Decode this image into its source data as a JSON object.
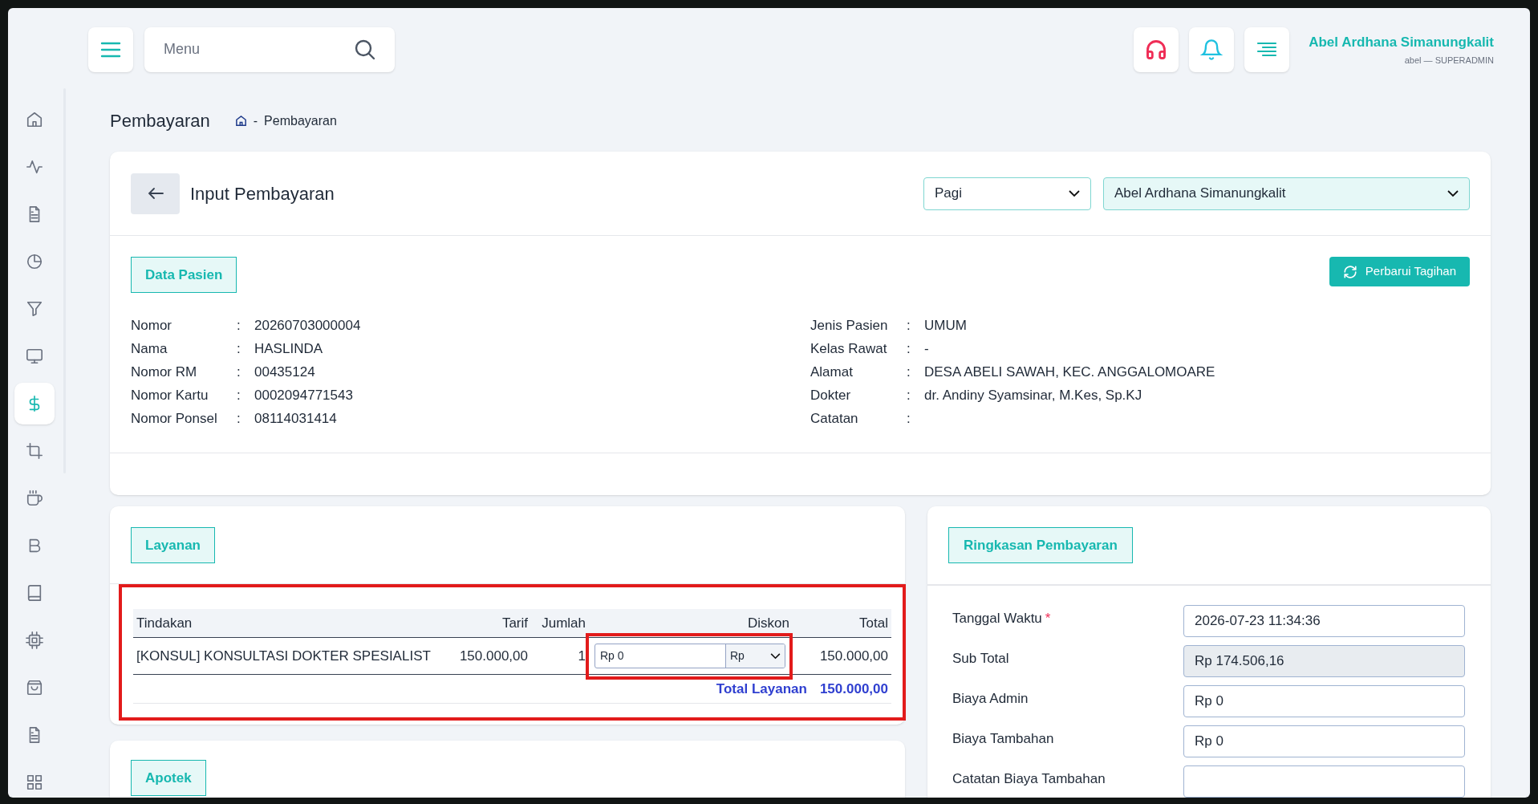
{
  "topbar": {
    "search": {
      "placeholder": "Menu"
    },
    "user": {
      "name": "Abel Ardhana Simanungkalit",
      "role": "abel — SUPERADMIN"
    }
  },
  "sidebar": {
    "items": [
      {
        "kind": "home",
        "selected": false
      },
      {
        "kind": "activity",
        "selected": false
      },
      {
        "kind": "file",
        "selected": false
      },
      {
        "kind": "pie",
        "selected": false
      },
      {
        "kind": "filter",
        "selected": false
      },
      {
        "kind": "monitor",
        "selected": false
      },
      {
        "kind": "dollar",
        "selected": true
      },
      {
        "kind": "crop",
        "selected": false
      },
      {
        "kind": "cup",
        "selected": false
      },
      {
        "kind": "bold",
        "selected": false
      },
      {
        "kind": "book",
        "selected": false
      },
      {
        "kind": "chip",
        "selected": false
      },
      {
        "kind": "bag",
        "selected": false
      },
      {
        "kind": "file",
        "selected": false
      },
      {
        "kind": "grid",
        "selected": false
      }
    ]
  },
  "page": {
    "title": "Pembayaran",
    "breadcrumb": [
      {
        "separator": "-",
        "label": "Pembayaran"
      }
    ]
  },
  "payment_card": {
    "title": "Input Pembayaran",
    "shift_select": {
      "value": "Pagi"
    },
    "staff_select": {
      "value": "Abel Ardhana Simanungkalit"
    },
    "section_label": "Data Pasien",
    "refresh_button": "Perbarui Tagihan",
    "left_fields": [
      {
        "label": "Nomor",
        "colon": ":",
        "value": "20260703000004"
      },
      {
        "label": "Nama",
        "colon": ":",
        "value": "HASLINDA"
      },
      {
        "label": "Nomor RM",
        "colon": ":",
        "value": "00435124"
      },
      {
        "label": "Nomor Kartu",
        "colon": ":",
        "value": "0002094771543"
      },
      {
        "label": "Nomor Ponsel",
        "colon": ":",
        "value": "08114031414"
      }
    ],
    "right_fields": [
      {
        "label": "Jenis Pasien",
        "colon": ":",
        "value": "UMUM"
      },
      {
        "label": "Kelas Rawat",
        "colon": ":",
        "value": "-"
      },
      {
        "label": "Alamat",
        "colon": ":",
        "value": "DESA ABELI SAWAH, KEC. ANGGALOMOARE"
      },
      {
        "label": "Dokter",
        "colon": ":",
        "value": "dr. Andiny Syamsinar, M.Kes, Sp.KJ"
      },
      {
        "label": "Catatan",
        "colon": ":"
      }
    ]
  },
  "services": {
    "section_label": "Layanan",
    "highlighted": true,
    "columns": [
      "Tindakan",
      "Tarif",
      "Jumlah",
      "Diskon",
      "Total"
    ],
    "rows": [
      {
        "tindakan": "[KONSUL] KONSULTASI DOKTER SPESIALIST",
        "tarif": "150.000,00",
        "jumlah": "1",
        "discount": {
          "value": "Rp 0",
          "unit": "Rp",
          "highlighted": true
        },
        "total": "150.000,00"
      }
    ],
    "total_label": "Total Layanan",
    "total_value": "150.000,00"
  },
  "summary": {
    "section_label": "Ringkasan Pembayaran",
    "fields": [
      {
        "label": "Tanggal Waktu",
        "required_mark": "*",
        "disabled": false,
        "value": "2026-07-23 11:34:36"
      },
      {
        "label": "Sub Total",
        "disabled": true,
        "value": "Rp 174.506,16"
      },
      {
        "label": "Biaya Admin",
        "disabled": false,
        "value": "Rp 0"
      },
      {
        "label": "Biaya Tambahan",
        "disabled": false,
        "value": "Rp 0"
      },
      {
        "label": "Catatan Biaya Tambahan",
        "disabled": false
      }
    ]
  },
  "pharmacy": {
    "section_label": "Apotek"
  }
}
